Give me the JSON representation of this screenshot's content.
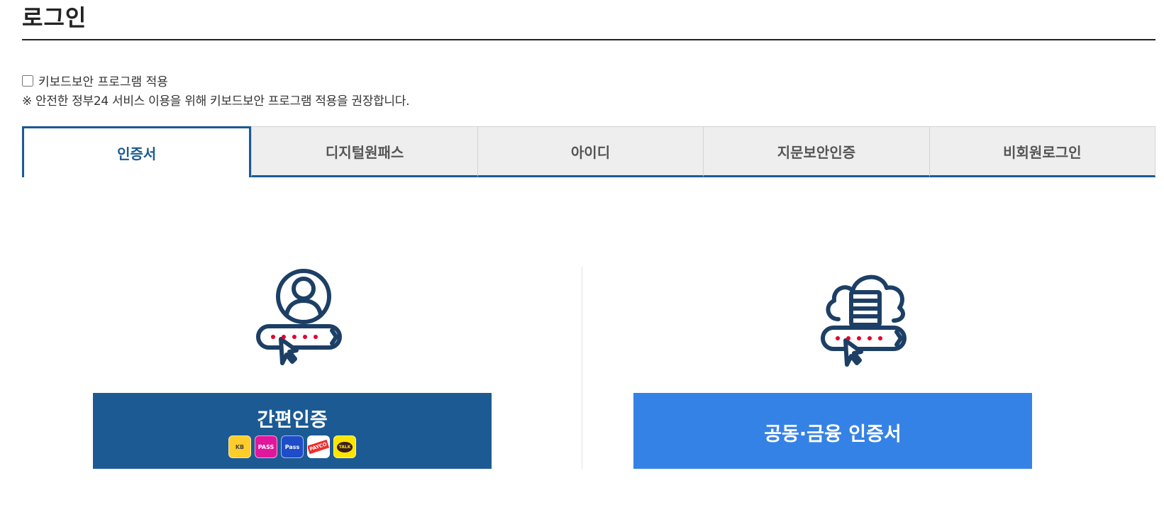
{
  "page": {
    "title": "로그인"
  },
  "keyboard_security": {
    "checkbox_label": "키보드보안 프로그램 적용",
    "checked": false,
    "notice": "※ 안전한 정부24 서비스 이용을 위해 키보드보안 프로그램 적용을 권장합니다."
  },
  "tabs": [
    {
      "label": "인증서",
      "active": true
    },
    {
      "label": "디지털원패스",
      "active": false
    },
    {
      "label": "아이디",
      "active": false
    },
    {
      "label": "지문보안인증",
      "active": false
    },
    {
      "label": "비회원로그인",
      "active": false
    }
  ],
  "options": {
    "simple": {
      "label": "간편인증",
      "icon": "user-password-icon",
      "providers": [
        {
          "name": "kb-icon",
          "text": "KB"
        },
        {
          "name": "pass-icon",
          "text": "PASS"
        },
        {
          "name": "samsung-pass-icon",
          "text": "Pass"
        },
        {
          "name": "payco-icon",
          "text": "PAYCO"
        },
        {
          "name": "kakao-talk-icon",
          "text": "TALK"
        }
      ]
    },
    "certificate": {
      "label": "공동·금융 인증서",
      "icon": "cloud-certificate-icon"
    }
  },
  "colors": {
    "primary": "#1c5a94",
    "accent": "#3582e6",
    "icon_dots": "#e4002b"
  }
}
